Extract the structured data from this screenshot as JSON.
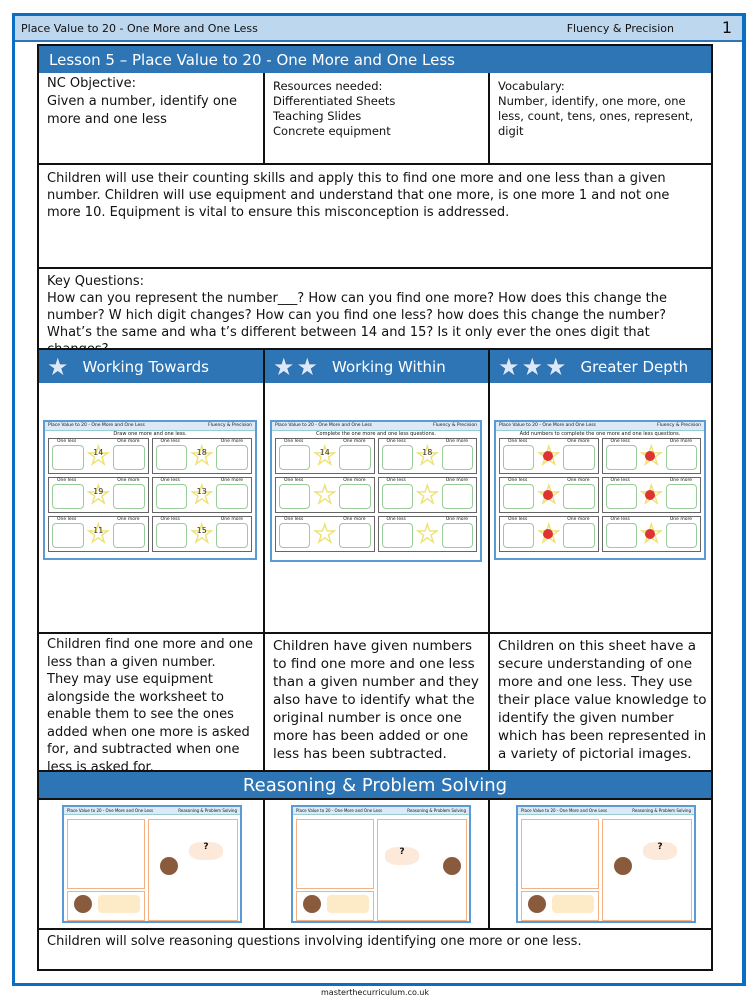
{
  "header": {
    "title": "Place Value to 20 - One More and One Less",
    "section": "Fluency & Precision",
    "page": "1"
  },
  "lesson": {
    "title": "Lesson 5 – Place Value to 20 - One More and One Less",
    "objective_label": "NC Objective:",
    "objective": "Given a number, identify one more and one less",
    "resources_label": "Resources needed:",
    "resources": [
      "Differentiated Sheets",
      "Teaching Slides",
      "Concrete equipment"
    ],
    "vocab_label": "Vocabulary:",
    "vocab": "Number, identify, one more, one less, count, tens, ones, represent, digit",
    "summary": "Children will use their counting skills and apply this to find one more and one less than a given number. Children will use equipment and understand that one more, is one more 1 and not one more 10. Equipment is vital to ensure this misconception is addressed.",
    "key_questions_label": "Key Questions:",
    "key_questions": "How can you represent the number___? How can you find one more? How does this change the number?    W hich digit changes? How can you find one less? how does this change the number? What’s the same and   wha t’s different between 14 and 15? Is it only ever the ones digit that changes?"
  },
  "levels": [
    {
      "label": "Working Towards",
      "stars": 1,
      "desc": "Children find one more and one less than a given number.\nThey may use equipment alongside the worksheet to enable them to see the ones added when one more is asked for, and subtracted when one less is asked for."
    },
    {
      "label": "Working Within",
      "stars": 2,
      "desc": "Children have given numbers to find one more and one less than a given number and they also have to identify what the original number is once one more has been added or one less has been subtracted."
    },
    {
      "label": "Greater Depth",
      "stars": 3,
      "desc": "Children on this sheet have a secure understanding of one more and one less. They use their place value knowledge to identify the given number which has been represented in a variety of pictorial images."
    }
  ],
  "worksheet": {
    "header": "Place Value to 20 - One More and One Less",
    "section": "Fluency & Precision",
    "less": "One less",
    "more": "One more",
    "titles": [
      "Draw one more and one less.",
      "Complete the one more and one less questions.",
      "Add numbers to complete the one more and one less questions."
    ],
    "numbers_wt": [
      "14",
      "18",
      "19",
      "13",
      "11",
      "15"
    ],
    "numbers_ww": [
      "14",
      "18",
      "",
      "",
      "",
      ""
    ]
  },
  "reasoning": {
    "title": "Reasoning & Problem Solving",
    "summary": "Children will solve reasoning questions involving identifying one more or one less.",
    "section": "Reasoning & Problem Solving",
    "q": "?"
  },
  "footer": "masterthecurriculum.co.uk",
  "colors": {
    "frame": "#0a6fc2",
    "header_band": "#bdd7ee",
    "table_header": "#2e75b6"
  }
}
